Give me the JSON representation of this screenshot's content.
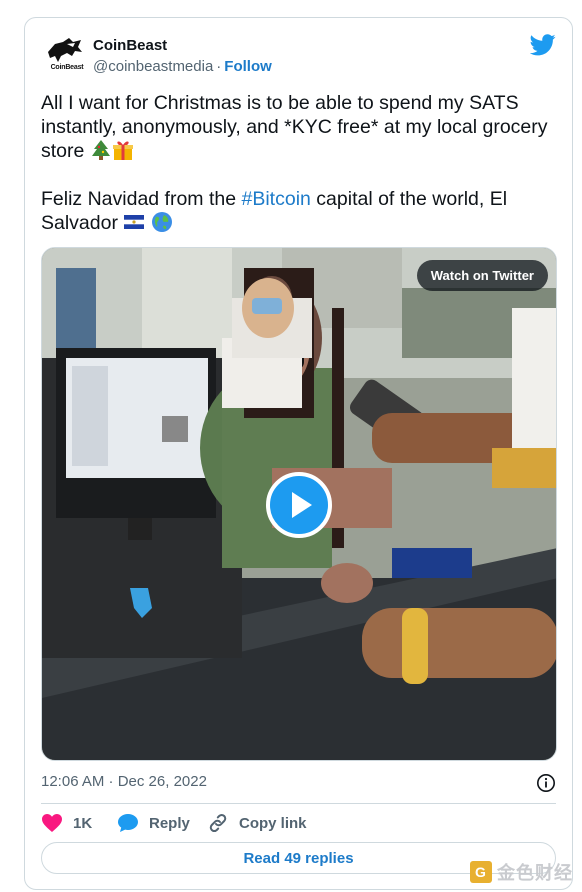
{
  "tweet": {
    "author_name": "CoinBeast",
    "avatar_label": "CoinBeast",
    "handle": "@coinbeastmedia",
    "separator": "·",
    "follow_label": "Follow",
    "text_line1": "All I want for Christmas is to be able to spend my SATS instantly, anonymously, and *KYC free* at my local grocery store",
    "text_line2_prefix": "Feliz Navidad from the ",
    "hashtag": "#Bitcoin",
    "text_line2_suffix": " capital of the world, El Salvador",
    "emoji_tree": "christmas-tree-emoji",
    "emoji_gift": "gift-emoji",
    "emoji_flag": "el-salvador-flag-emoji",
    "emoji_globe": "globe-emoji"
  },
  "media": {
    "watch_label": "Watch on Twitter",
    "play_icon": "play-icon"
  },
  "meta": {
    "timestamp": "12:06 AM · Dec 26, 2022",
    "info_icon": "info-icon"
  },
  "actions": {
    "like_count": "1K",
    "reply_label": "Reply",
    "copy_label": "Copy link"
  },
  "read_replies_label": "Read 49 replies",
  "watermark": {
    "text": "金色财经",
    "logo_glyph": "G"
  },
  "colors": {
    "link": "#1d7bc9",
    "twitter_blue": "#1d9bf0",
    "heart": "#f91880",
    "muted": "#536471",
    "border": "#cfd9de"
  }
}
